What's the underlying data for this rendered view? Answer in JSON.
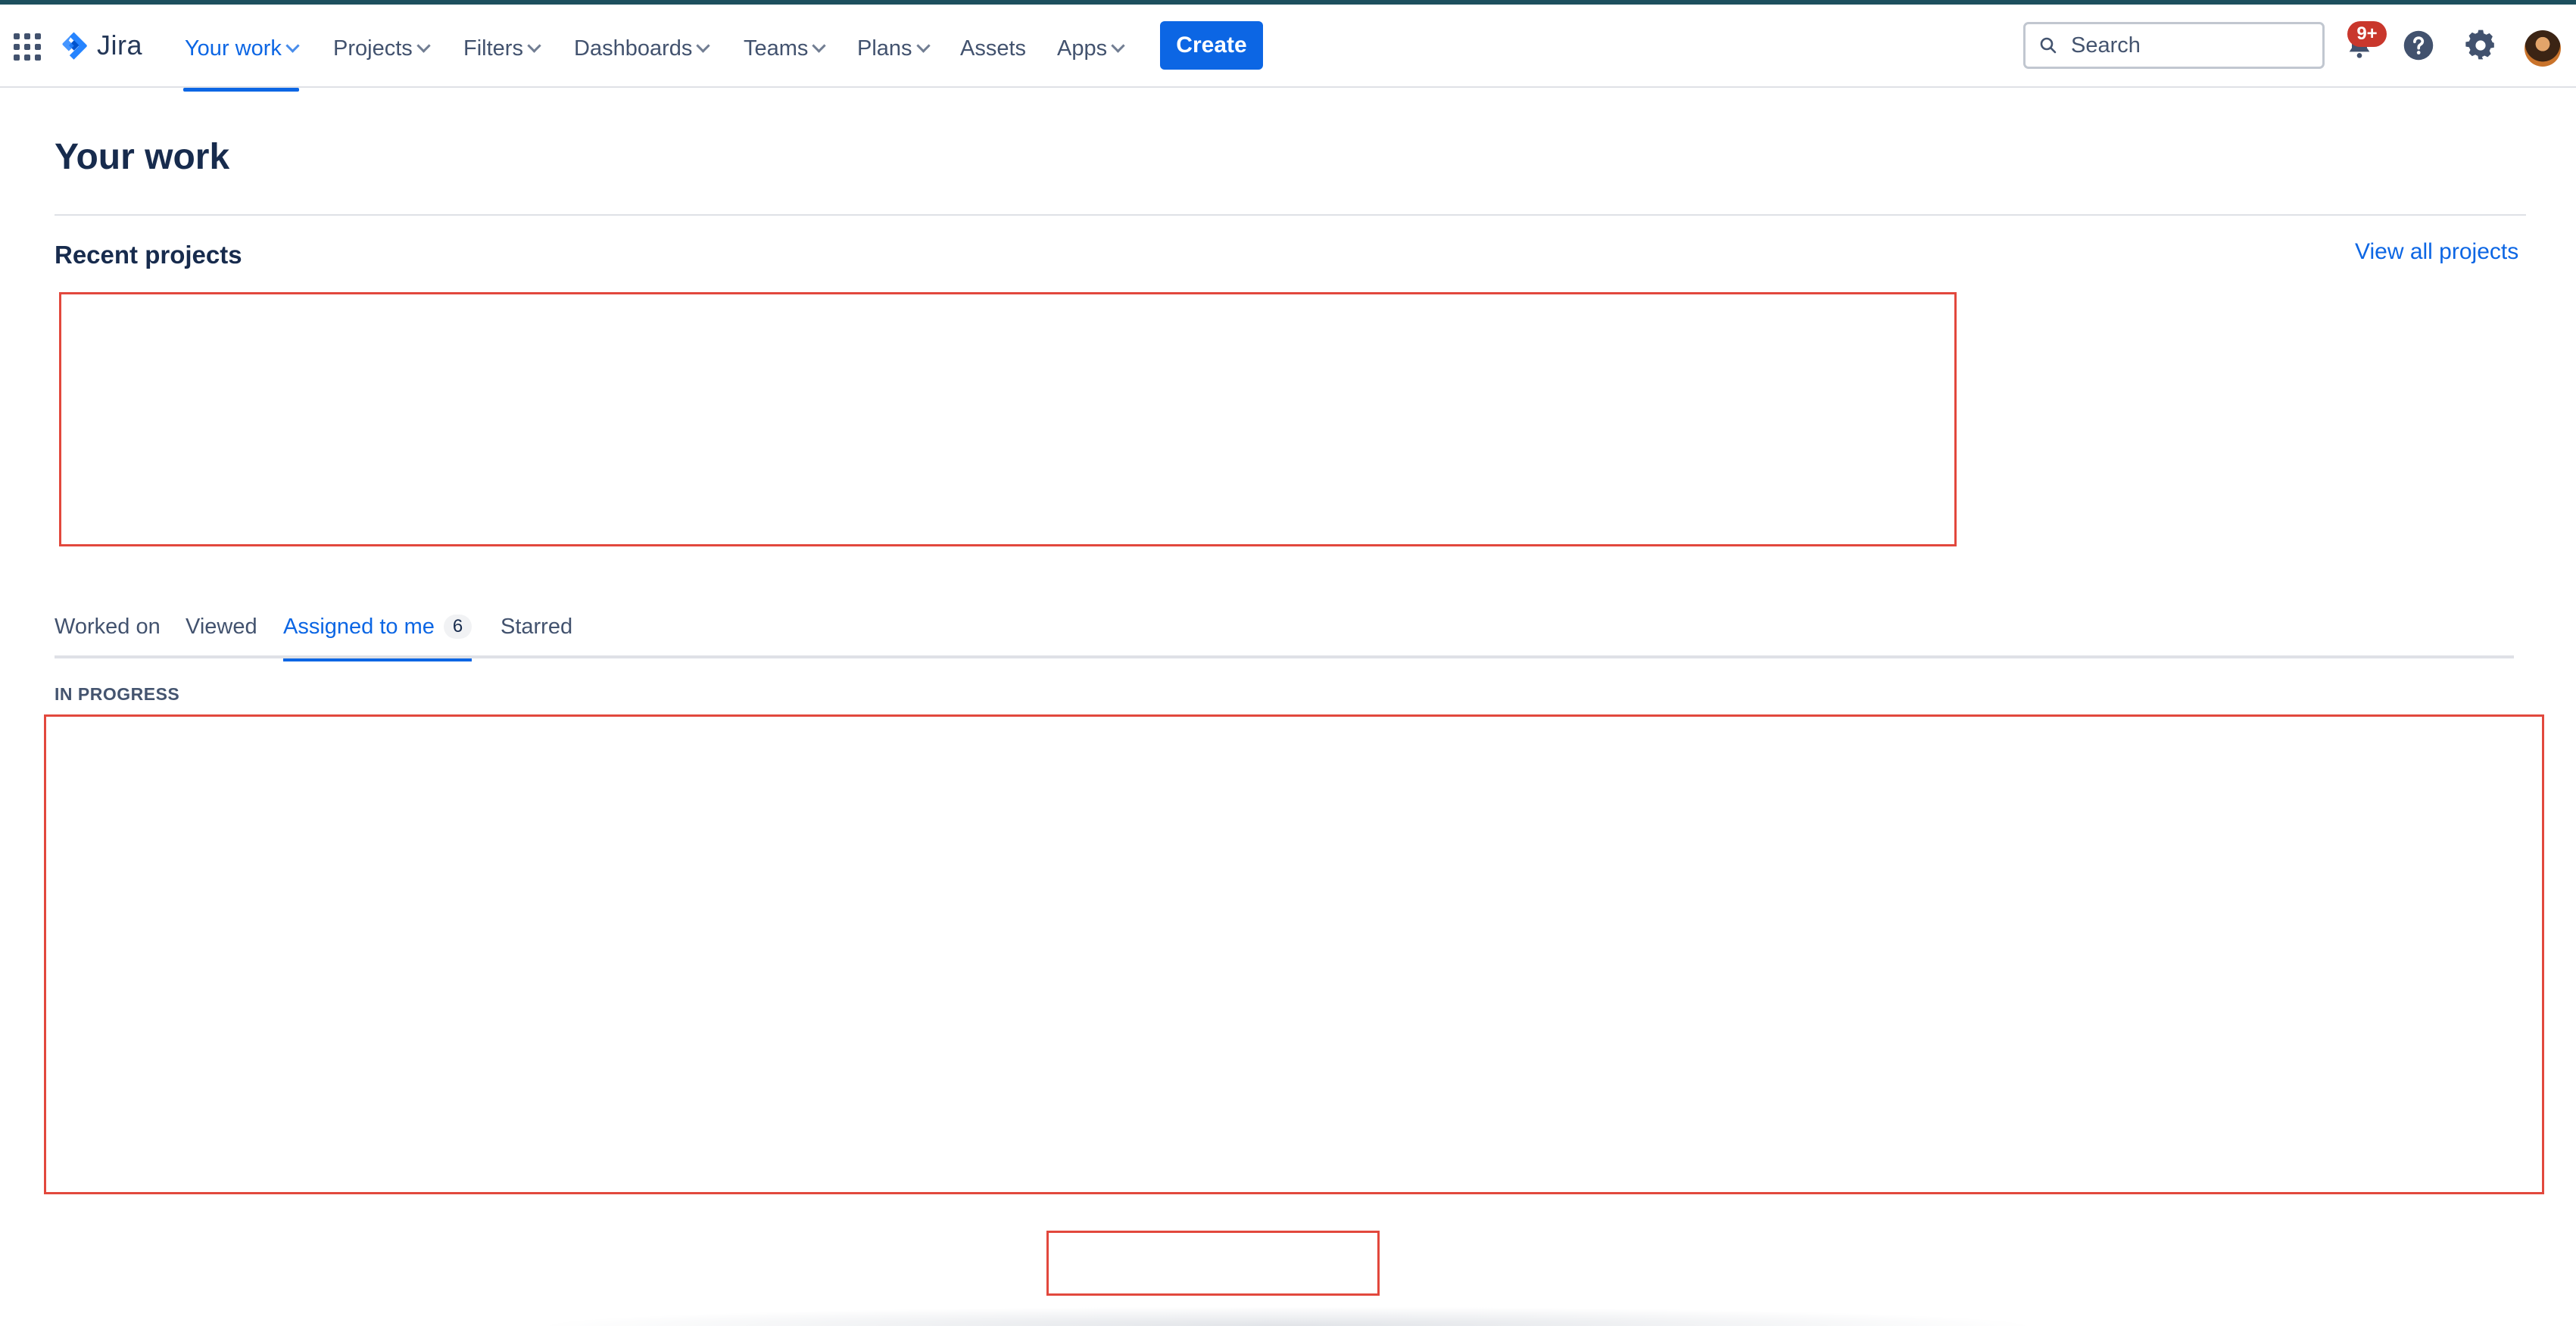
{
  "header": {
    "app_name": "Jira",
    "nav_items": [
      {
        "label": "Your work",
        "active": true,
        "dropdown": true
      },
      {
        "label": "Projects",
        "active": false,
        "dropdown": true
      },
      {
        "label": "Filters",
        "active": false,
        "dropdown": true
      },
      {
        "label": "Dashboards",
        "active": false,
        "dropdown": true
      },
      {
        "label": "Teams",
        "active": false,
        "dropdown": true
      },
      {
        "label": "Plans",
        "active": false,
        "dropdown": true
      },
      {
        "label": "Assets",
        "active": false,
        "dropdown": false
      },
      {
        "label": "Apps",
        "active": false,
        "dropdown": true
      }
    ],
    "create_label": "Create",
    "search_placeholder": "Search",
    "notification_badge": "9+",
    "icons": [
      "app-switcher-icon",
      "jira-logo-icon",
      "search-icon",
      "bell-icon",
      "help-icon",
      "settings-icon",
      "avatar"
    ]
  },
  "main": {
    "title": "Your work",
    "recent_projects_title": "Recent projects",
    "view_all_label": "View all projects",
    "tabs": [
      {
        "label": "Worked on",
        "active": false
      },
      {
        "label": "Viewed",
        "active": false
      },
      {
        "label": "Assigned to me",
        "active": true,
        "count": "6"
      },
      {
        "label": "Starred",
        "active": false
      }
    ],
    "group_label": "IN PROGRESS"
  },
  "colors": {
    "accent": "#0c66e4",
    "badge": "#c9372c",
    "redaction_border": "#e2483d",
    "top_stripe": "#1d4f5e"
  }
}
